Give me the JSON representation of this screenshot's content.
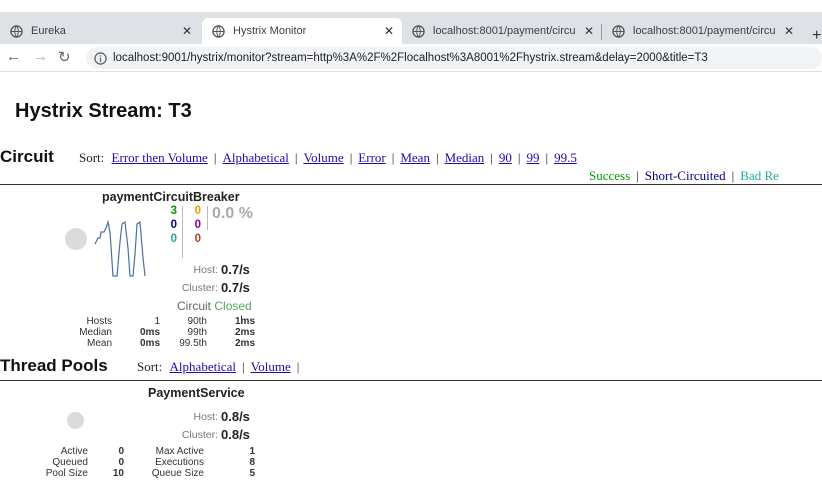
{
  "browser": {
    "tabs": [
      {
        "title": "Eureka",
        "icon": "globe-icon"
      },
      {
        "title": "Hystrix Monitor",
        "icon": "globe-icon"
      },
      {
        "title": "localhost:8001/payment/circu",
        "icon": "globe-icon"
      },
      {
        "title": "localhost:8001/payment/circu",
        "icon": "globe-icon"
      }
    ],
    "url": "localhost:9001/hystrix/monitor?stream=http%3A%2F%2Flocalhost%3A8001%2Fhystrix.stream&delay=2000&title=T3"
  },
  "page": {
    "title": "Hystrix Stream: T3",
    "circuit": {
      "heading": "Circuit",
      "sort_label": "Sort:",
      "sort_links": [
        "Error then Volume",
        "Alphabetical",
        "Volume",
        "Error",
        "Mean",
        "Median",
        "90",
        "99",
        "99.5"
      ],
      "legend": {
        "success": "Success",
        "short_circuited": "Short-Circuited",
        "bad_request": "Bad Re"
      },
      "colors": {
        "success": "#090",
        "short_circuited": "#00008b",
        "bad_request": "#1aad9a",
        "timeout": "#f0a000",
        "rejected": "#8b008b",
        "failure": "#c0392b"
      },
      "card": {
        "name": "paymentCircuitBreaker",
        "counts_left": [
          "3",
          "0",
          "0"
        ],
        "counts_right": [
          "0",
          "0",
          "0"
        ],
        "error_pct": "0.0 %",
        "host_label": "Host:",
        "host_rate": "0.7/s",
        "cluster_label": "Cluster:",
        "cluster_rate": "0.7/s",
        "circuit_label": "Circuit",
        "circuit_state": "Closed",
        "stats": {
          "hosts_label": "Hosts",
          "hosts": "1",
          "median_label": "Median",
          "median": "0ms",
          "mean_label": "Mean",
          "mean": "0ms",
          "p90_label": "90th",
          "p90": "1ms",
          "p99_label": "99th",
          "p99": "2ms",
          "p995_label": "99.5th",
          "p995": "2ms"
        }
      }
    },
    "thread_pools": {
      "heading": "Thread Pools",
      "sort_label": "Sort:",
      "sort_links": [
        "Alphabetical",
        "Volume"
      ],
      "card": {
        "name": "PaymentService",
        "host_label": "Host:",
        "host_rate": "0.8/s",
        "cluster_label": "Cluster:",
        "cluster_rate": "0.8/s",
        "stats": {
          "active_label": "Active",
          "active": "0",
          "queued_label": "Queued",
          "queued": "0",
          "pool_size_label": "Pool Size",
          "pool_size": "10",
          "max_active_label": "Max Active",
          "max_active": "1",
          "executions_label": "Executions",
          "executions": "8",
          "queue_size_label": "Queue Size",
          "queue_size": "5"
        }
      }
    }
  }
}
